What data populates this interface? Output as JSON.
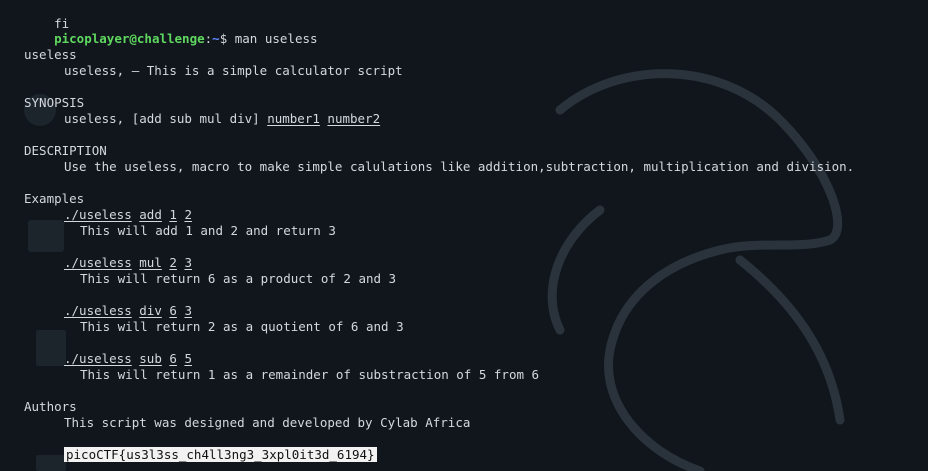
{
  "terminal": {
    "prev_line": "fi",
    "prompt": {
      "user_host": "picoplayer@challenge",
      "separator": ":",
      "path": "~",
      "symbol": "$",
      "command": "man useless"
    }
  },
  "man": {
    "name_header": "useless",
    "name_desc": "useless, — This is a simple calculator script",
    "synopsis_header": "SYNOPSIS",
    "synopsis_text": "useless, [add sub mul div] ",
    "synopsis_arg1": "number1",
    "synopsis_arg2": "number2",
    "description_header": "DESCRIPTION",
    "description_text": "Use the useless, macro to make simple calulations like addition,subtraction, multiplication and division.",
    "examples_header": "Examples",
    "examples": [
      {
        "cmd": "./useless",
        "op": "add",
        "a": "1",
        "b": "2",
        "desc": "This will add 1 and 2 and return 3"
      },
      {
        "cmd": "./useless",
        "op": "mul",
        "a": "2",
        "b": "3",
        "desc": "This will return 6 as a product of 2 and 3"
      },
      {
        "cmd": "./useless",
        "op": "div",
        "a": "6",
        "b": "3",
        "desc": "This will return 2 as a quotient of 6 and 3"
      },
      {
        "cmd": "./useless",
        "op": "sub",
        "a": "6",
        "b": "5",
        "desc": "This will return 1 as a remainder of substraction of 5 from 6"
      }
    ],
    "authors_header": "Authors",
    "authors_text": "This script was designed and developed by Cylab Africa",
    "flag": "picoCTF{us3l3ss_ch4ll3ng3_3xpl0it3d_6194}"
  },
  "colors": {
    "background": "#10161c",
    "text": "#d5d8dc",
    "prompt_user": "#5fd75f",
    "prompt_path": "#5f87ff",
    "highlight_bg": "#f2f2f2"
  },
  "icons": [
    "kali-dragon-watermark"
  ]
}
